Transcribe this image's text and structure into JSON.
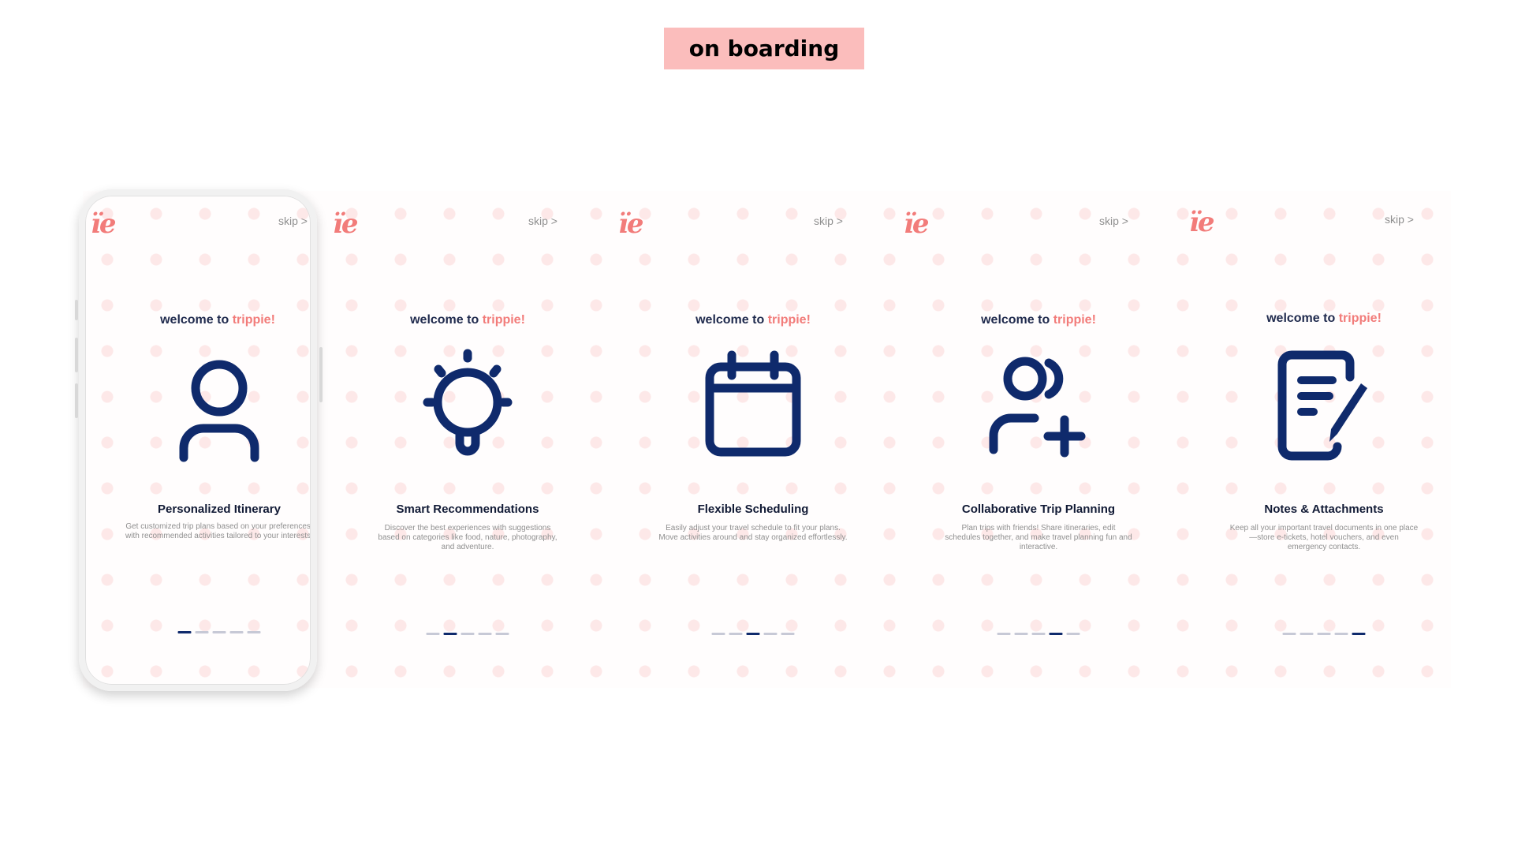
{
  "header": {
    "section_label": "on boarding"
  },
  "brand": {
    "logo_text": "ïe",
    "welcome_prefix": "welcome to",
    "welcome_brand": "trippie!",
    "skip_label": "skip >"
  },
  "colors": {
    "brand_pink": "#f27c7a",
    "label_pink": "#fbbdbc",
    "icon_navy": "#0f2a6c",
    "inactive_dot": "#c7c9d6"
  },
  "screens": [
    {
      "icon": "user-icon",
      "title": "Personalized Itinerary",
      "description": "Get customized trip plans based on your preferences, with recommended activities tailored to your interests.",
      "active_step": 1,
      "total_steps": 5
    },
    {
      "icon": "lightbulb-icon",
      "title": "Smart Recommendations",
      "description": "Discover the best experiences with suggestions based on categories like food, nature, photography, and adventure.",
      "active_step": 2,
      "total_steps": 5
    },
    {
      "icon": "calendar-icon",
      "title": "Flexible Scheduling",
      "description": "Easily adjust your travel schedule to fit your plans. Move activities around and stay organized effortlessly.",
      "active_step": 3,
      "total_steps": 5
    },
    {
      "icon": "add-user-icon",
      "title": "Collaborative Trip Planning",
      "description": "Plan trips with friends! Share itineraries, edit schedules together, and make travel planning fun and interactive.",
      "active_step": 4,
      "total_steps": 5
    },
    {
      "icon": "notes-pen-icon",
      "title": "Notes & Attachments",
      "description": "Keep all your important travel documents in one place—store e-tickets, hotel vouchers, and even emergency contacts.",
      "active_step": 5,
      "total_steps": 5
    }
  ]
}
